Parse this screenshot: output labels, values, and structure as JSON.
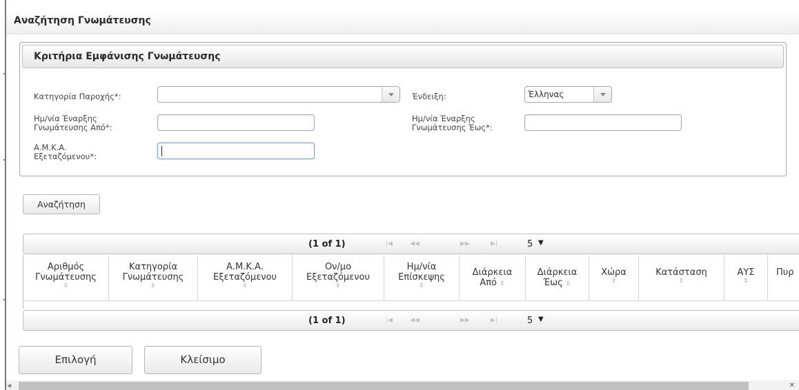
{
  "dialog": {
    "title": "Αναζήτηση Γνωμάτευσης"
  },
  "criteria": {
    "legend": "Κριτήρια Εμφάνισης Γνωμάτευσης",
    "category_label": "Κατηγορία Παροχής*:",
    "category_value": "",
    "indication_label": "Ένδειξη:",
    "indication_value": "Έλληνας",
    "date_from_label_1": "Ημ/νία Έναρξης",
    "date_from_label_2": "Γνωμάτευσης Από*:",
    "date_from_value": "",
    "date_to_label_1": "Ημ/νία Έναρξης",
    "date_to_label_2": "Γνωμάτευσης Έως*:",
    "date_to_value": "",
    "amka_label_1": "Α.Μ.Κ.Α.",
    "amka_label_2": "Εξεταζόμενου*:",
    "amka_value": ""
  },
  "search_button": "Αναζήτηση",
  "paginator": {
    "current": "(1 of 1)",
    "first": "|◀",
    "prev": "◀◀",
    "next": "▶▶",
    "last": "▶|",
    "rows_per_page": "5",
    "rows_arrow": "▼"
  },
  "table": {
    "columns": [
      {
        "l1": "Αριθμός",
        "l2": "Γνωμάτευσης"
      },
      {
        "l1": "Κατηγορία",
        "l2": "Γνωμάτευσης"
      },
      {
        "l1": "Α.Μ.Κ.Α.",
        "l2": "Εξεταζόμενου"
      },
      {
        "l1": "Ον/μο",
        "l2": "Εξεταζόμενου"
      },
      {
        "l1": "Ημ/νία",
        "l2": "Επίσκεψης"
      },
      {
        "l1": "Διάρκεια",
        "l2": "Από"
      },
      {
        "l1": "Διάρκεια",
        "l2": "Έως"
      },
      {
        "l1": "Χώρα",
        "l2": ""
      },
      {
        "l1": "Κατάσταση",
        "l2": ""
      },
      {
        "l1": "ΑΥΣ",
        "l2": ""
      },
      {
        "l1": "Πυρ",
        "l2": ""
      }
    ],
    "sort_icon": "⇳",
    "rows": []
  },
  "footer": {
    "select_button": "Επιλογή",
    "close_button": "Κλείσιμο"
  },
  "scrollbar": {
    "left_arrow": "◀",
    "right_arrow": "✕"
  }
}
